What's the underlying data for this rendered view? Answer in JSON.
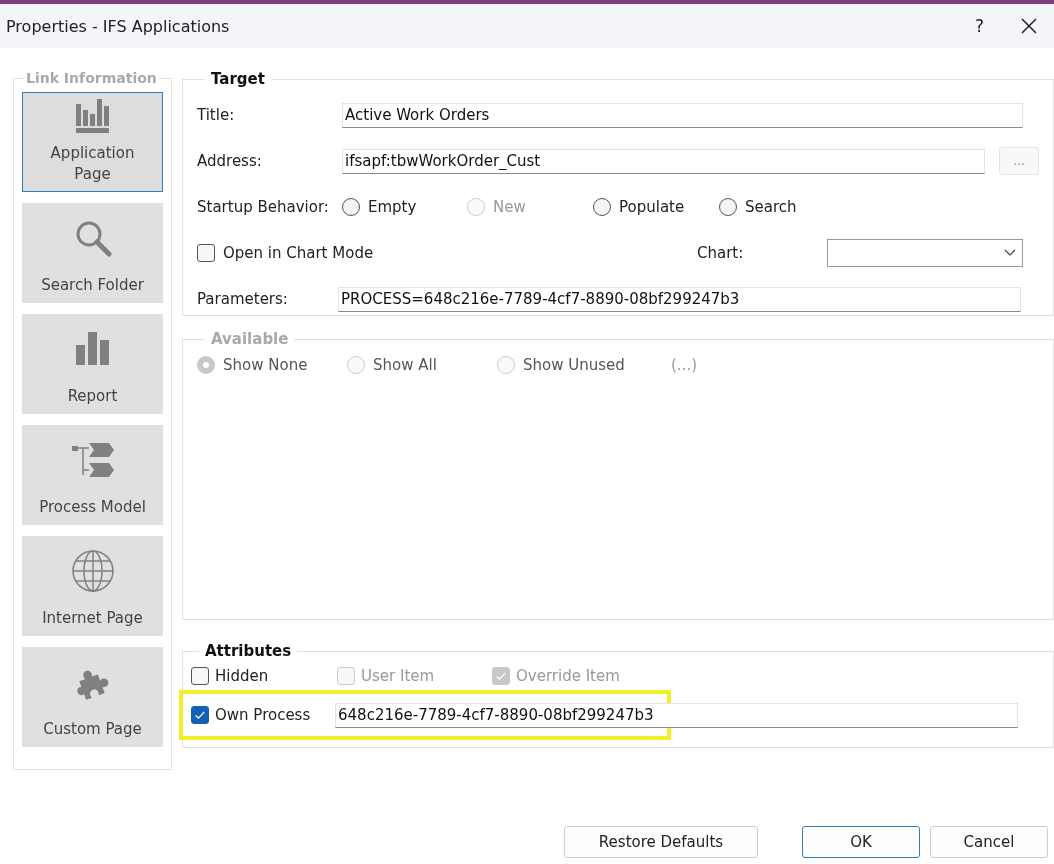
{
  "window": {
    "title": "Properties - IFS Applications",
    "help": "?"
  },
  "link_information": {
    "title": "Link Information",
    "items": [
      {
        "label": "Application Page",
        "kind": "chart",
        "selected": true
      },
      {
        "label": "Search Folder",
        "kind": "search",
        "selected": false
      },
      {
        "label": "Report",
        "kind": "bars",
        "selected": false
      },
      {
        "label": "Process Model",
        "kind": "process",
        "selected": false
      },
      {
        "label": "Internet Page",
        "kind": "globe",
        "selected": false
      },
      {
        "label": "Custom Page",
        "kind": "puzzle",
        "selected": false
      }
    ]
  },
  "target": {
    "title": "Target",
    "title_field": {
      "label": "Title:",
      "value": "Active Work Orders"
    },
    "address_field": {
      "label": "Address:",
      "value": "ifsapf:tbwWorkOrder_Cust",
      "button": "..."
    },
    "startup_behavior": {
      "label": "Startup Behavior:",
      "options": [
        {
          "label": "Empty",
          "selected": false,
          "disabled": false
        },
        {
          "label": "New",
          "selected": false,
          "disabled": true
        },
        {
          "label": "Populate",
          "selected": false,
          "disabled": false
        },
        {
          "label": "Search",
          "selected": false,
          "disabled": false
        }
      ]
    },
    "chart_mode": {
      "label": "Open in Chart Mode",
      "checked": false
    },
    "chart": {
      "label": "Chart:"
    },
    "parameters": {
      "label": "Parameters:",
      "value": "PROCESS=648c216e-7789-4cf7-8890-08bf299247b3"
    }
  },
  "available": {
    "title": "Available",
    "disabled": true,
    "options": [
      {
        "label": "Show None",
        "selected": true
      },
      {
        "label": "Show All",
        "selected": false
      },
      {
        "label": "Show Unused",
        "selected": false
      }
    ],
    "more": "(...)"
  },
  "attributes": {
    "title": "Attributes",
    "checks": [
      {
        "label": "Hidden",
        "checked": false,
        "disabled": false
      },
      {
        "label": "User Item",
        "checked": false,
        "disabled": true
      },
      {
        "label": "Override Item",
        "checked": true,
        "disabled": true
      }
    ],
    "own_process": {
      "label": "Own Process",
      "checked": true,
      "value": "648c216e-7789-4cf7-8890-08bf299247b3",
      "highlighted": true
    }
  },
  "buttons": [
    {
      "label": "Restore Defaults",
      "default": false
    },
    {
      "label": "OK",
      "default": true
    },
    {
      "label": "Cancel",
      "default": false
    }
  ]
}
